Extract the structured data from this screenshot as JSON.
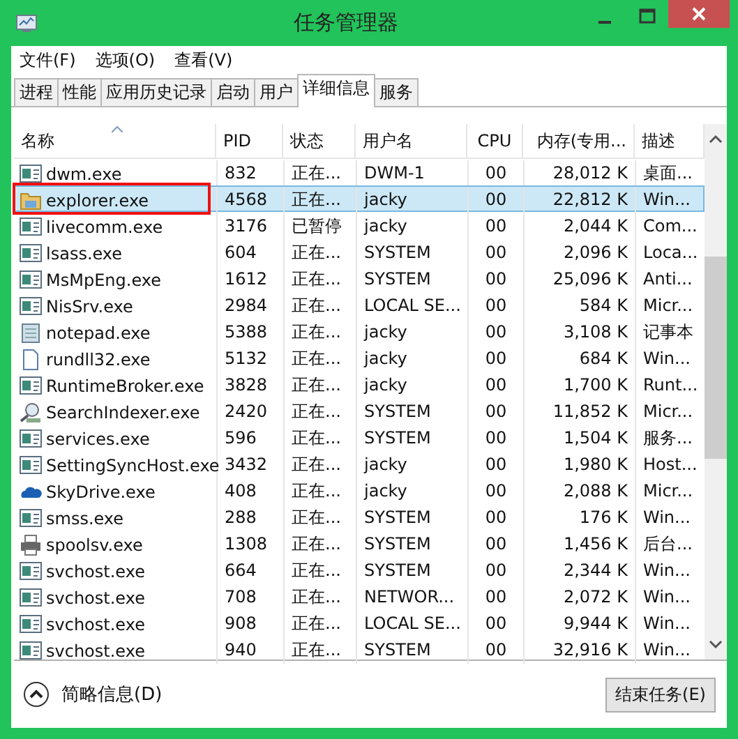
{
  "window": {
    "title": "任务管理器"
  },
  "menu": [
    "文件(F)",
    "选项(O)",
    "查看(V)"
  ],
  "tabs": [
    {
      "label": "进程",
      "selected": false
    },
    {
      "label": "性能",
      "selected": false
    },
    {
      "label": "应用历史记录",
      "selected": false
    },
    {
      "label": "启动",
      "selected": false
    },
    {
      "label": "用户",
      "selected": false
    },
    {
      "label": "详细信息",
      "selected": true
    },
    {
      "label": "服务",
      "selected": false
    }
  ],
  "table": {
    "columns": [
      "名称",
      "PID",
      "状态",
      "用户名",
      "CPU",
      "内存(专用...",
      "描述"
    ],
    "rows": [
      {
        "kind": "app",
        "cells": [
          "dwm.exe",
          "832",
          "正在...",
          "DWM-1",
          "00",
          "28,012 K",
          "桌面..."
        ],
        "selected": false,
        "highlighted": false
      },
      {
        "kind": "folder",
        "cells": [
          "explorer.exe",
          "4568",
          "正在...",
          "jacky",
          "00",
          "22,812 K",
          "Win..."
        ],
        "selected": true,
        "highlighted": true
      },
      {
        "kind": "app",
        "cells": [
          "livecomm.exe",
          "3176",
          "已暂停",
          "jacky",
          "00",
          "2,044 K",
          "Com..."
        ],
        "selected": false,
        "highlighted": false
      },
      {
        "kind": "app",
        "cells": [
          "lsass.exe",
          "604",
          "正在...",
          "SYSTEM",
          "00",
          "2,096 K",
          "Loca..."
        ],
        "selected": false,
        "highlighted": false
      },
      {
        "kind": "app",
        "cells": [
          "MsMpEng.exe",
          "1612",
          "正在...",
          "SYSTEM",
          "00",
          "25,096 K",
          "Anti..."
        ],
        "selected": false,
        "highlighted": false
      },
      {
        "kind": "app",
        "cells": [
          "NisSrv.exe",
          "2984",
          "正在...",
          "LOCAL SE...",
          "00",
          "584 K",
          "Micr..."
        ],
        "selected": false,
        "highlighted": false
      },
      {
        "kind": "notepad",
        "cells": [
          "notepad.exe",
          "5388",
          "正在...",
          "jacky",
          "00",
          "3,108 K",
          "记事本"
        ],
        "selected": false,
        "highlighted": false
      },
      {
        "kind": "document",
        "cells": [
          "rundll32.exe",
          "5132",
          "正在...",
          "jacky",
          "00",
          "684 K",
          "Win..."
        ],
        "selected": false,
        "highlighted": false
      },
      {
        "kind": "app",
        "cells": [
          "RuntimeBroker.exe",
          "3828",
          "正在...",
          "jacky",
          "00",
          "1,700 K",
          "Runt..."
        ],
        "selected": false,
        "highlighted": false
      },
      {
        "kind": "search",
        "cells": [
          "SearchIndexer.exe",
          "2420",
          "正在...",
          "SYSTEM",
          "00",
          "11,852 K",
          "Micr..."
        ],
        "selected": false,
        "highlighted": false
      },
      {
        "kind": "app",
        "cells": [
          "services.exe",
          "596",
          "正在...",
          "SYSTEM",
          "00",
          "1,504 K",
          "服务..."
        ],
        "selected": false,
        "highlighted": false
      },
      {
        "kind": "app",
        "cells": [
          "SettingSyncHost.exe",
          "3432",
          "正在...",
          "jacky",
          "00",
          "1,980 K",
          "Host..."
        ],
        "selected": false,
        "highlighted": false
      },
      {
        "kind": "cloud",
        "cells": [
          "SkyDrive.exe",
          "408",
          "正在...",
          "jacky",
          "00",
          "2,088 K",
          "Micr..."
        ],
        "selected": false,
        "highlighted": false
      },
      {
        "kind": "app",
        "cells": [
          "smss.exe",
          "288",
          "正在...",
          "SYSTEM",
          "00",
          "176 K",
          "Win..."
        ],
        "selected": false,
        "highlighted": false
      },
      {
        "kind": "printer",
        "cells": [
          "spoolsv.exe",
          "1308",
          "正在...",
          "SYSTEM",
          "00",
          "1,456 K",
          "后台..."
        ],
        "selected": false,
        "highlighted": false
      },
      {
        "kind": "app",
        "cells": [
          "svchost.exe",
          "664",
          "正在...",
          "SYSTEM",
          "00",
          "2,344 K",
          "Win..."
        ],
        "selected": false,
        "highlighted": false
      },
      {
        "kind": "app",
        "cells": [
          "svchost.exe",
          "708",
          "正在...",
          "NETWOR...",
          "00",
          "2,072 K",
          "Win..."
        ],
        "selected": false,
        "highlighted": false
      },
      {
        "kind": "app",
        "cells": [
          "svchost.exe",
          "908",
          "正在...",
          "LOCAL SE...",
          "00",
          "9,944 K",
          "Win..."
        ],
        "selected": false,
        "highlighted": false
      },
      {
        "kind": "app",
        "cells": [
          "svchost.exe",
          "940",
          "正在...",
          "SYSTEM",
          "00",
          "32,916 K",
          "Win..."
        ],
        "selected": false,
        "highlighted": false
      }
    ]
  },
  "footer": {
    "details_toggle": "简略信息(D)",
    "end_task_button": "结束任务(E)"
  }
}
